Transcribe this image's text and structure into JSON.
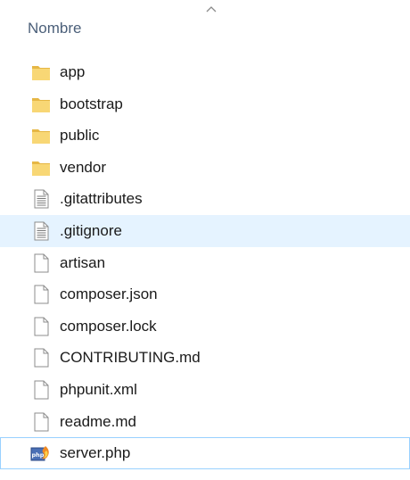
{
  "header": {
    "column_title": "Nombre",
    "sort_direction": "ascending"
  },
  "files": [
    {
      "name": "app",
      "icon": "folder-icon",
      "type": "folder"
    },
    {
      "name": "bootstrap",
      "icon": "folder-icon",
      "type": "folder"
    },
    {
      "name": "public",
      "icon": "folder-icon",
      "type": "folder"
    },
    {
      "name": "vendor",
      "icon": "folder-icon",
      "type": "folder"
    },
    {
      "name": ".gitattributes",
      "icon": "text-file-icon",
      "type": "text"
    },
    {
      "name": ".gitignore",
      "icon": "text-file-icon",
      "type": "text",
      "state": "hover"
    },
    {
      "name": "artisan",
      "icon": "blank-file-icon",
      "type": "blank"
    },
    {
      "name": "composer.json",
      "icon": "blank-file-icon",
      "type": "blank"
    },
    {
      "name": "composer.lock",
      "icon": "blank-file-icon",
      "type": "blank"
    },
    {
      "name": "CONTRIBUTING.md",
      "icon": "blank-file-icon",
      "type": "blank"
    },
    {
      "name": "phpunit.xml",
      "icon": "blank-file-icon",
      "type": "blank"
    },
    {
      "name": "readme.md",
      "icon": "blank-file-icon",
      "type": "blank"
    },
    {
      "name": "server.php",
      "icon": "php-file-icon",
      "type": "php",
      "state": "selected"
    }
  ],
  "colors": {
    "folder": "#f8d775",
    "folder_dark": "#e6b745",
    "hover_bg": "#e5f3ff",
    "selected_border": "#99d1ff",
    "header_text": "#4c607a"
  }
}
